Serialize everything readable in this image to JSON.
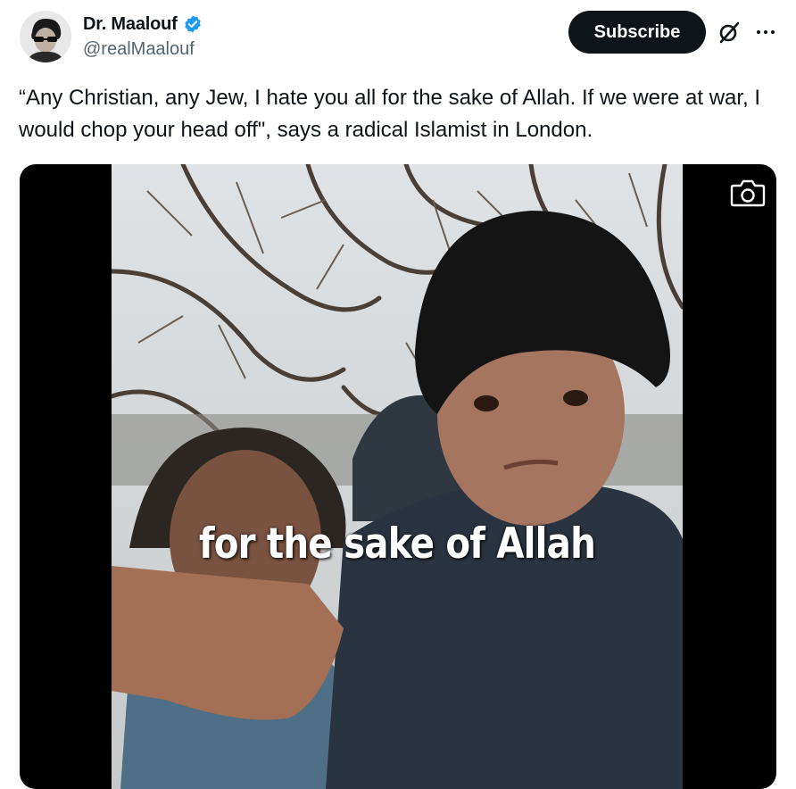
{
  "author": {
    "display_name": "Dr. Maalouf",
    "handle": "@realMaalouf",
    "verified": true,
    "verified_color": "#1d9bf0",
    "avatar_icon": "user-avatar"
  },
  "actions": {
    "subscribe_label": "Subscribe",
    "grok_icon": "grok-icon",
    "more_icon": "more-icon"
  },
  "post": {
    "text": "“Any Christian, any Jew, I hate you all for the sake of Allah. If we were at war, I would chop your head off\", says a radical Islamist in London."
  },
  "media": {
    "type": "video",
    "caption": "for the sake of Allah",
    "camera_icon": "camera-icon"
  },
  "colors": {
    "text": "#0f1419",
    "secondary_text": "#536471",
    "button_bg": "#0f1419",
    "button_text": "#ffffff",
    "media_bg": "#000000"
  }
}
